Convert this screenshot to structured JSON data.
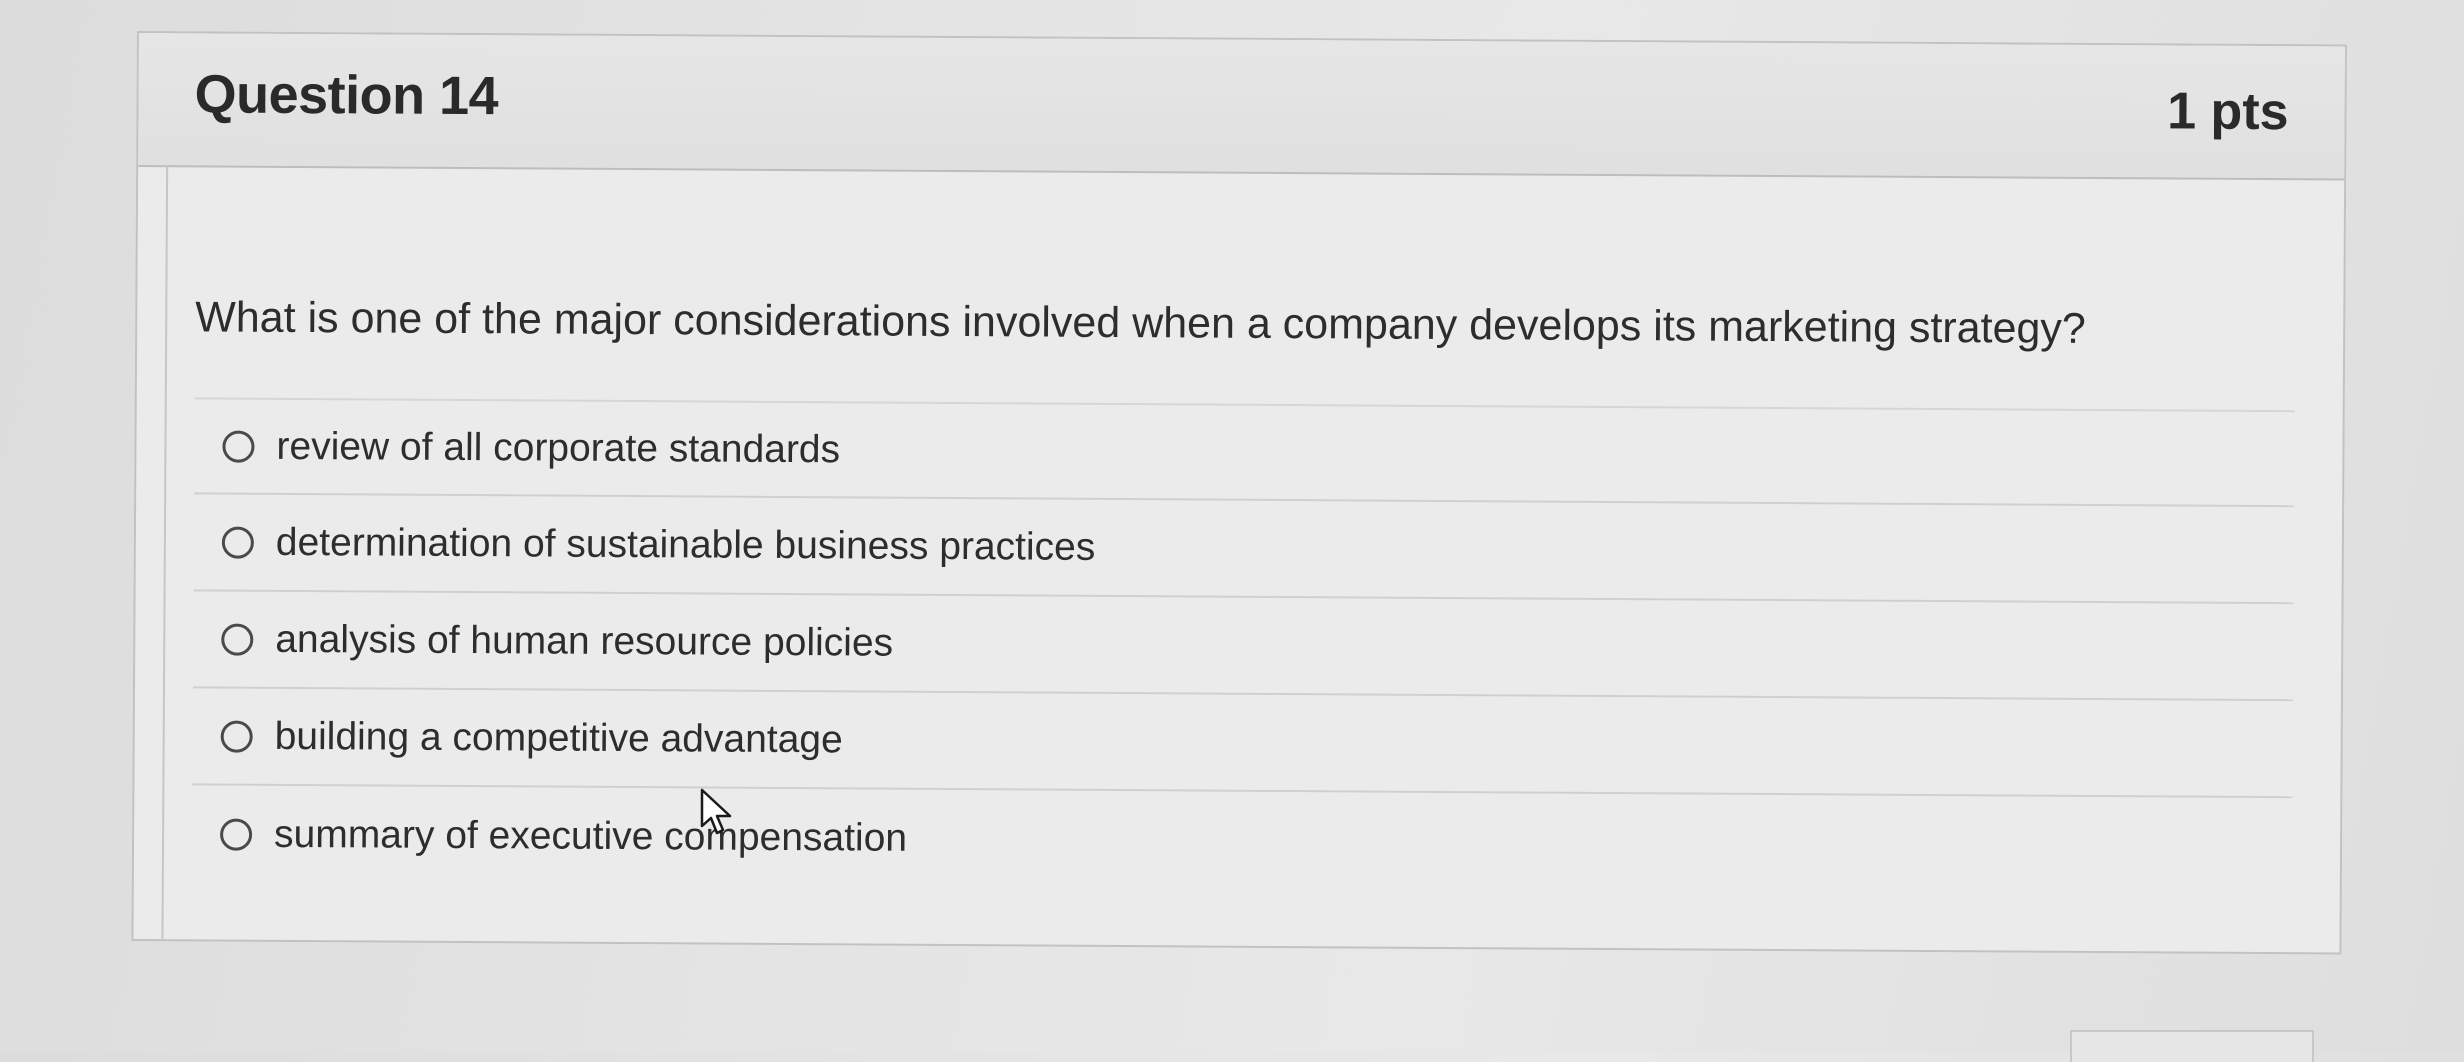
{
  "question": {
    "title": "Question 14",
    "points": "1 pts",
    "text": "What is one of the major considerations involved when a company develops its marketing strategy?"
  },
  "answers": [
    {
      "label": "review of all corporate standards",
      "selected": false
    },
    {
      "label": "determination of sustainable business practices",
      "selected": false
    },
    {
      "label": "analysis of human resource policies",
      "selected": false
    },
    {
      "label": "building a competitive advantage",
      "selected": false
    },
    {
      "label": "summary of executive compensation",
      "selected": false
    }
  ]
}
